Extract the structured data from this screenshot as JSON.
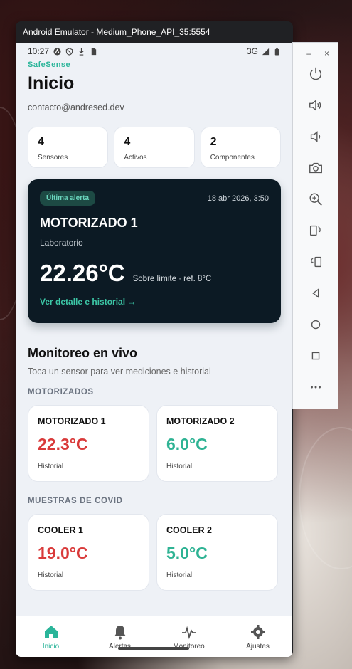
{
  "window": {
    "title": "Android Emulator - Medium_Phone_API_35:5554"
  },
  "status_bar": {
    "time": "10:27",
    "network": "3G"
  },
  "app": {
    "brand": "SafeSense",
    "title": "Inicio",
    "email": "contacto@andresed.dev"
  },
  "stats": [
    {
      "value": "4",
      "label": "Sensores"
    },
    {
      "value": "4",
      "label": "Activos"
    },
    {
      "value": "2",
      "label": "Componentes"
    }
  ],
  "alert": {
    "badge": "Última alerta",
    "date": "18 abr 2026, 3:50",
    "name": "MOTORIZADO 1",
    "location": "Laboratorio",
    "value": "22.26°C",
    "note": "Sobre límite · ref. 8°C",
    "link": "Ver detalle e historial →"
  },
  "monitor": {
    "title": "Monitoreo en vivo",
    "subtitle": "Toca un sensor para ver mediciones e historial",
    "groups": [
      {
        "label": "MOTORIZADOS",
        "sensors": [
          {
            "name": "MOTORIZADO 1",
            "temp": "22.3°C",
            "history": "Historial",
            "status": "hot"
          },
          {
            "name": "MOTORIZADO 2",
            "temp": "6.0°C",
            "history": "Historial",
            "status": "cool"
          }
        ]
      },
      {
        "label": "MUESTRAS DE COVID",
        "sensors": [
          {
            "name": "COOLER 1",
            "temp": "19.0°C",
            "history": "Historial",
            "status": "hot"
          },
          {
            "name": "COOLER 2",
            "temp": "5.0°C",
            "history": "Historial",
            "status": "cool"
          }
        ]
      }
    ]
  },
  "nav": {
    "items": [
      {
        "label": "Inicio",
        "icon": "home-icon"
      },
      {
        "label": "Alertas",
        "icon": "bell-icon"
      },
      {
        "label": "Monitoreo",
        "icon": "pulse-icon"
      },
      {
        "label": "Ajustes",
        "icon": "gear-icon"
      }
    ]
  },
  "colors": {
    "accent": "#2bb59a",
    "hot": "#d93a3a",
    "alert_bg": "#0c1a24"
  },
  "toolbar": {
    "minimize": "–",
    "close": "×",
    "buttons": [
      "power-icon",
      "volume-up-icon",
      "volume-down-icon",
      "camera-icon",
      "zoom-in-icon",
      "rotate-left-icon",
      "rotate-right-icon",
      "back-icon",
      "home-circle-icon",
      "overview-icon",
      "more-icon"
    ]
  }
}
